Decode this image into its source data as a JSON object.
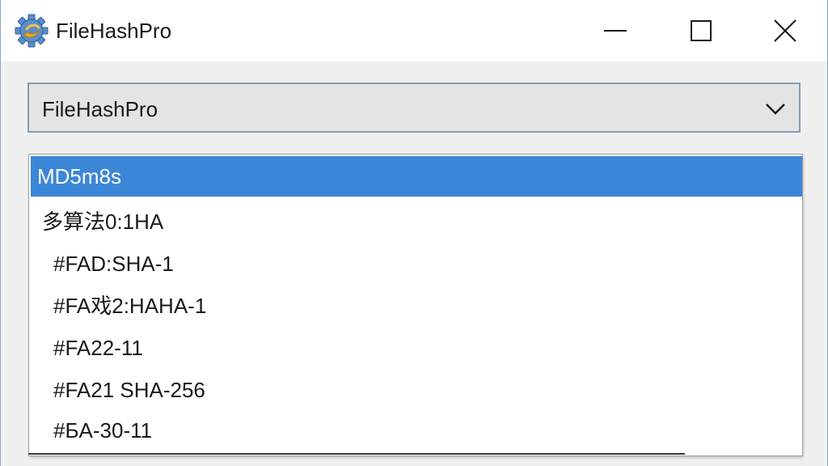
{
  "window": {
    "title": "FileHashPro",
    "controls": {
      "minimize_icon": "minimize-icon",
      "maximize_icon": "maximize-icon",
      "close_icon": "close-icon"
    }
  },
  "dropdown": {
    "selected_value": "FileHashPro",
    "chevron_icon": "chevron-down-icon"
  },
  "listbox": {
    "items": [
      {
        "label": "MD5m8s",
        "selected": true
      },
      {
        "label": "多算法0:1HA",
        "selected": false
      },
      {
        "label": "#FAD:SHA-1",
        "selected": false
      },
      {
        "label": "#FA戏2:HAHA-1",
        "selected": false
      },
      {
        "label": "#FA22-11",
        "selected": false
      },
      {
        "label": "#FA21 SHA-256",
        "selected": false
      },
      {
        "label": "#БA-30-11",
        "selected": false
      }
    ]
  },
  "colors": {
    "selection": "#3c86d8",
    "titlebar": "#ffffff",
    "window_bg": "#f0f0f0",
    "dropdown_bg": "#e4e4e4",
    "dropdown_border": "#7f9db9"
  }
}
